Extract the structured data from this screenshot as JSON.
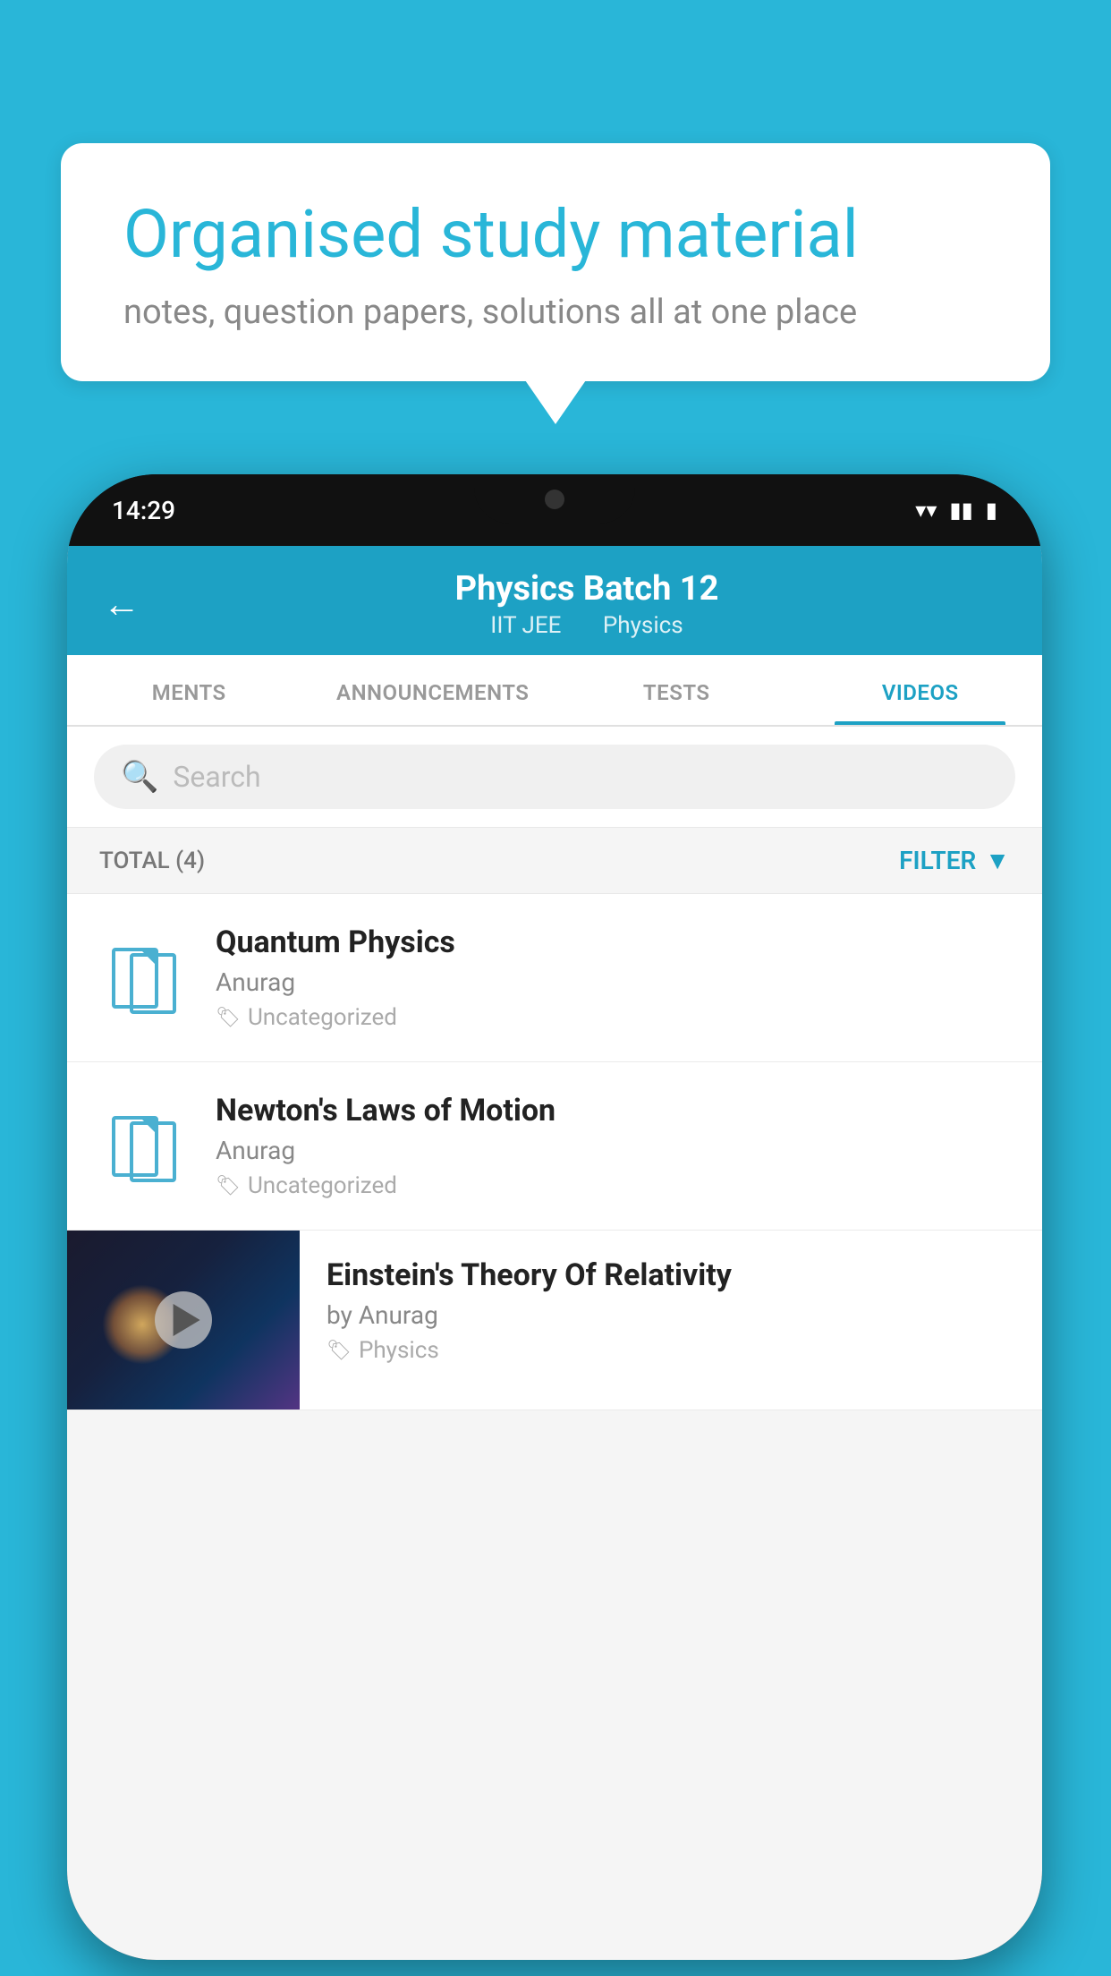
{
  "background_color": "#29b6d8",
  "speech_bubble": {
    "title": "Organised study material",
    "subtitle": "notes, question papers, solutions all at one place"
  },
  "phone": {
    "time": "14:29",
    "header": {
      "title": "Physics Batch 12",
      "subtitle_part1": "IIT JEE",
      "subtitle_part2": "Physics"
    },
    "tabs": [
      {
        "label": "MENTS",
        "active": false
      },
      {
        "label": "ANNOUNCEMENTS",
        "active": false
      },
      {
        "label": "TESTS",
        "active": false
      },
      {
        "label": "VIDEOS",
        "active": true
      }
    ],
    "search": {
      "placeholder": "Search"
    },
    "filter_bar": {
      "total_label": "TOTAL (4)",
      "filter_label": "FILTER"
    },
    "video_items": [
      {
        "id": 1,
        "title": "Quantum Physics",
        "author": "Anurag",
        "tag": "Uncategorized",
        "has_thumbnail": false
      },
      {
        "id": 2,
        "title": "Newton's Laws of Motion",
        "author": "Anurag",
        "tag": "Uncategorized",
        "has_thumbnail": false
      },
      {
        "id": 3,
        "title": "Einstein's Theory Of Relativity",
        "author": "by Anurag",
        "tag": "Physics",
        "has_thumbnail": true
      }
    ]
  }
}
